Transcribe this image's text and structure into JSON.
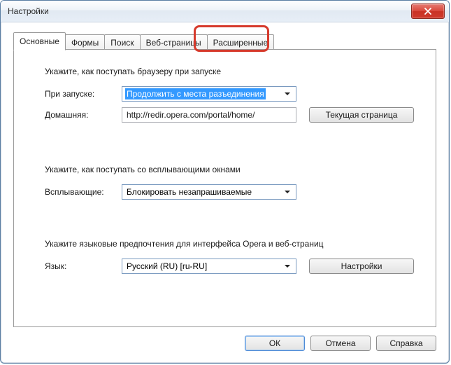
{
  "window": {
    "title": "Настройки"
  },
  "tabs": [
    {
      "label": "Основные"
    },
    {
      "label": "Формы"
    },
    {
      "label": "Поиск"
    },
    {
      "label": "Веб-страницы"
    },
    {
      "label": "Расширенные"
    }
  ],
  "startup": {
    "heading": "Укажите, как поступать браузеру при запуске",
    "on_launch_label": "При запуске:",
    "on_launch_value": "Продолжить с места разъединения",
    "home_label": "Домашняя:",
    "home_value": "http://redir.opera.com/portal/home/",
    "current_page_button": "Текущая страница"
  },
  "popups": {
    "heading": "Укажите, как поступать со всплывающими окнами",
    "label": "Всплывающие:",
    "value": "Блокировать незапрашиваемые"
  },
  "language": {
    "heading": "Укажите языковые предпочтения для интерфейса Opera и веб-страниц",
    "label": "Язык:",
    "value": "Русский (RU) [ru-RU]",
    "settings_button": "Настройки"
  },
  "buttons": {
    "ok": "ОК",
    "cancel": "Отмена",
    "help": "Справка"
  }
}
